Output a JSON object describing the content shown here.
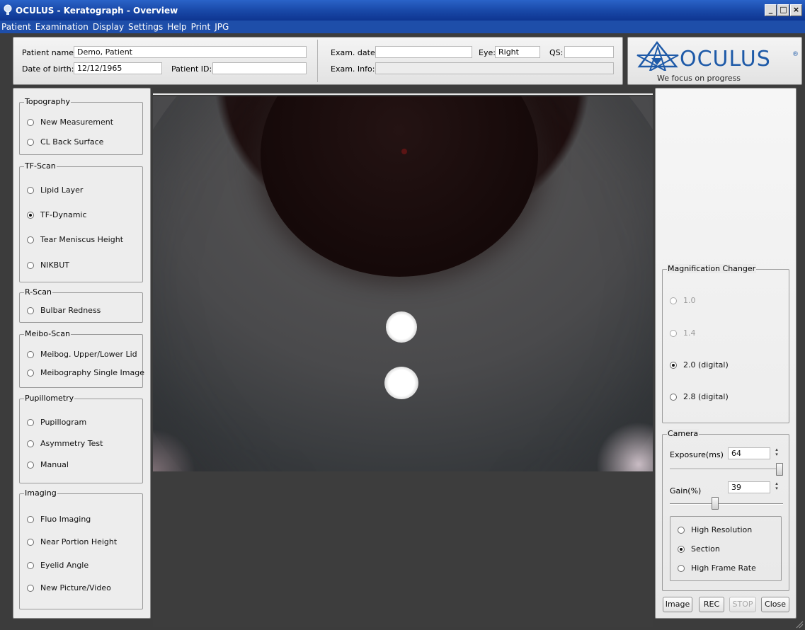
{
  "window": {
    "title": "OCULUS - Keratograph - Overview"
  },
  "menu": [
    "Patient",
    "Examination",
    "Display",
    "Settings",
    "Help",
    "Print",
    "JPG"
  ],
  "patient": {
    "name_label": "Patient name:",
    "name": "Demo, Patient",
    "dob_label": "Date of birth:",
    "dob": "12/12/1965",
    "id_label": "Patient ID:",
    "id": "",
    "exam_date_label": "Exam. date:",
    "exam_date": "",
    "eye_label": "Eye:",
    "eye": "Right",
    "qs_label": "QS:",
    "qs": "",
    "exam_info_label": "Exam. Info:",
    "exam_info": ""
  },
  "logo": {
    "brand": "OCULUS",
    "registered": "®",
    "tagline": "We focus on progress"
  },
  "left": {
    "topography": {
      "title": "Topography",
      "items": [
        "New Measurement",
        "CL Back Surface"
      ]
    },
    "tfscan": {
      "title": "TF-Scan",
      "items": [
        "Lipid Layer",
        "TF-Dynamic",
        "Tear Meniscus Height",
        "NIKBUT"
      ],
      "selected": "TF-Dynamic"
    },
    "rscan": {
      "title": "R-Scan",
      "items": [
        "Bulbar Redness"
      ]
    },
    "meiboscan": {
      "title": "Meibo-Scan",
      "items": [
        "Meibog. Upper/Lower Lid",
        "Meibography Single Image"
      ]
    },
    "pupillometry": {
      "title": "Pupillometry",
      "items": [
        "Pupillogram",
        "Asymmetry Test",
        "Manual"
      ]
    },
    "imaging": {
      "title": "Imaging",
      "items": [
        "Fluo Imaging",
        "Near Portion Height",
        "Eyelid Angle",
        "New Picture/Video"
      ]
    }
  },
  "right": {
    "magnification": {
      "title": "Magnification Changer",
      "items": [
        "1.0",
        "1.4",
        "2.0 (digital)",
        "2.8 (digital)"
      ],
      "selected": "2.0 (digital)"
    },
    "camera": {
      "title": "Camera",
      "exposure_label": "Exposure(ms)",
      "exposure": "64",
      "exposure_level": 1.0,
      "gain_label": "Gain(%)",
      "gain": "39",
      "gain_level": 0.39,
      "modes": [
        "High Resolution",
        "Section",
        "High Frame Rate"
      ],
      "selected_mode": "Section"
    },
    "buttons": {
      "image": "Image",
      "rec": "REC",
      "stop": "STOP",
      "close": "Close"
    }
  },
  "colors": {
    "titlebar": "#1847a6",
    "menubar": "#1e4ea9",
    "brand": "#1e5aa8",
    "workspace": "#3c3c3c"
  }
}
